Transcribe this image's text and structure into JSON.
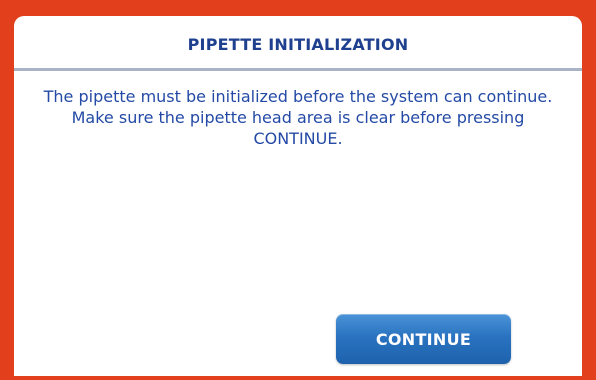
{
  "dialog": {
    "title": "PIPETTE INITIALIZATION",
    "message_line_1": "The pipette must be initialized before the system can continue.",
    "message_line_2": "Make sure the pipette head area is clear before pressing CONTINUE.",
    "continue_label": "CONTINUE"
  },
  "colors": {
    "frame": "#e23f1c",
    "title_text": "#1f3f8f",
    "message_text": "#244aa6",
    "button": "#2a73c0"
  }
}
